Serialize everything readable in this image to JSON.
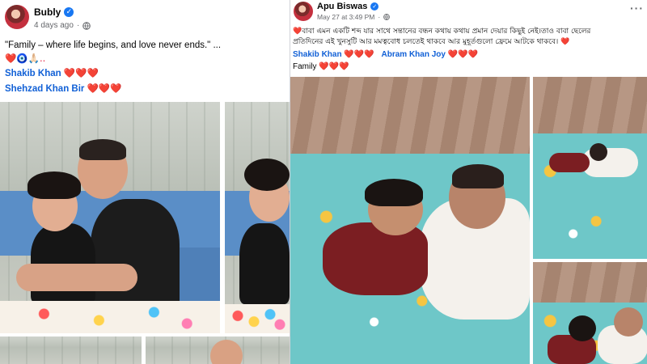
{
  "left_post": {
    "author": "Bubly",
    "time": "4 days ago",
    "privacy": "·",
    "caption": "\"Family – where life begins, and love never ends.\" ...",
    "emoji_line": "❤️🧿🙏🏻..",
    "tags": [
      {
        "name": "Shakib Khan",
        "hearts": "❤️❤️❤️"
      },
      {
        "name": "Shehzad Khan Bir",
        "hearts": "❤️❤️❤️"
      }
    ]
  },
  "right_post": {
    "author": "Apu Biswas",
    "time": "May 27 at 3:49 PM",
    "privacy": "·",
    "caption_lead": "❤️",
    "caption_line1": "বাবা এমন একটি শব্দ যার সাথে সন্তানের বন্ধন কথায় কথায় প্রমান দেয়ার কিছুই নেই।তাও বাবা ছেলের",
    "caption_line2": "প্রতিদিনের এই খুনসুটি আর মমত্ববোধ চলতেই থাকবে আর মুহূর্তগুলো ফ্রেমে আটকে থাকবে। ❤️",
    "tags": [
      {
        "name": "Shakib Khan",
        "hearts": "❤️❤️❤️"
      },
      {
        "name": "Abram Khan Joy",
        "hearts": "❤️❤️❤️"
      }
    ],
    "footer_word": "Family",
    "footer_hearts": "❤️❤️❤️",
    "more": "···"
  },
  "colors": {
    "link": "#1160d6",
    "verified": "#1877f2",
    "heart": "#e41e3f",
    "meta": "#65676b"
  }
}
